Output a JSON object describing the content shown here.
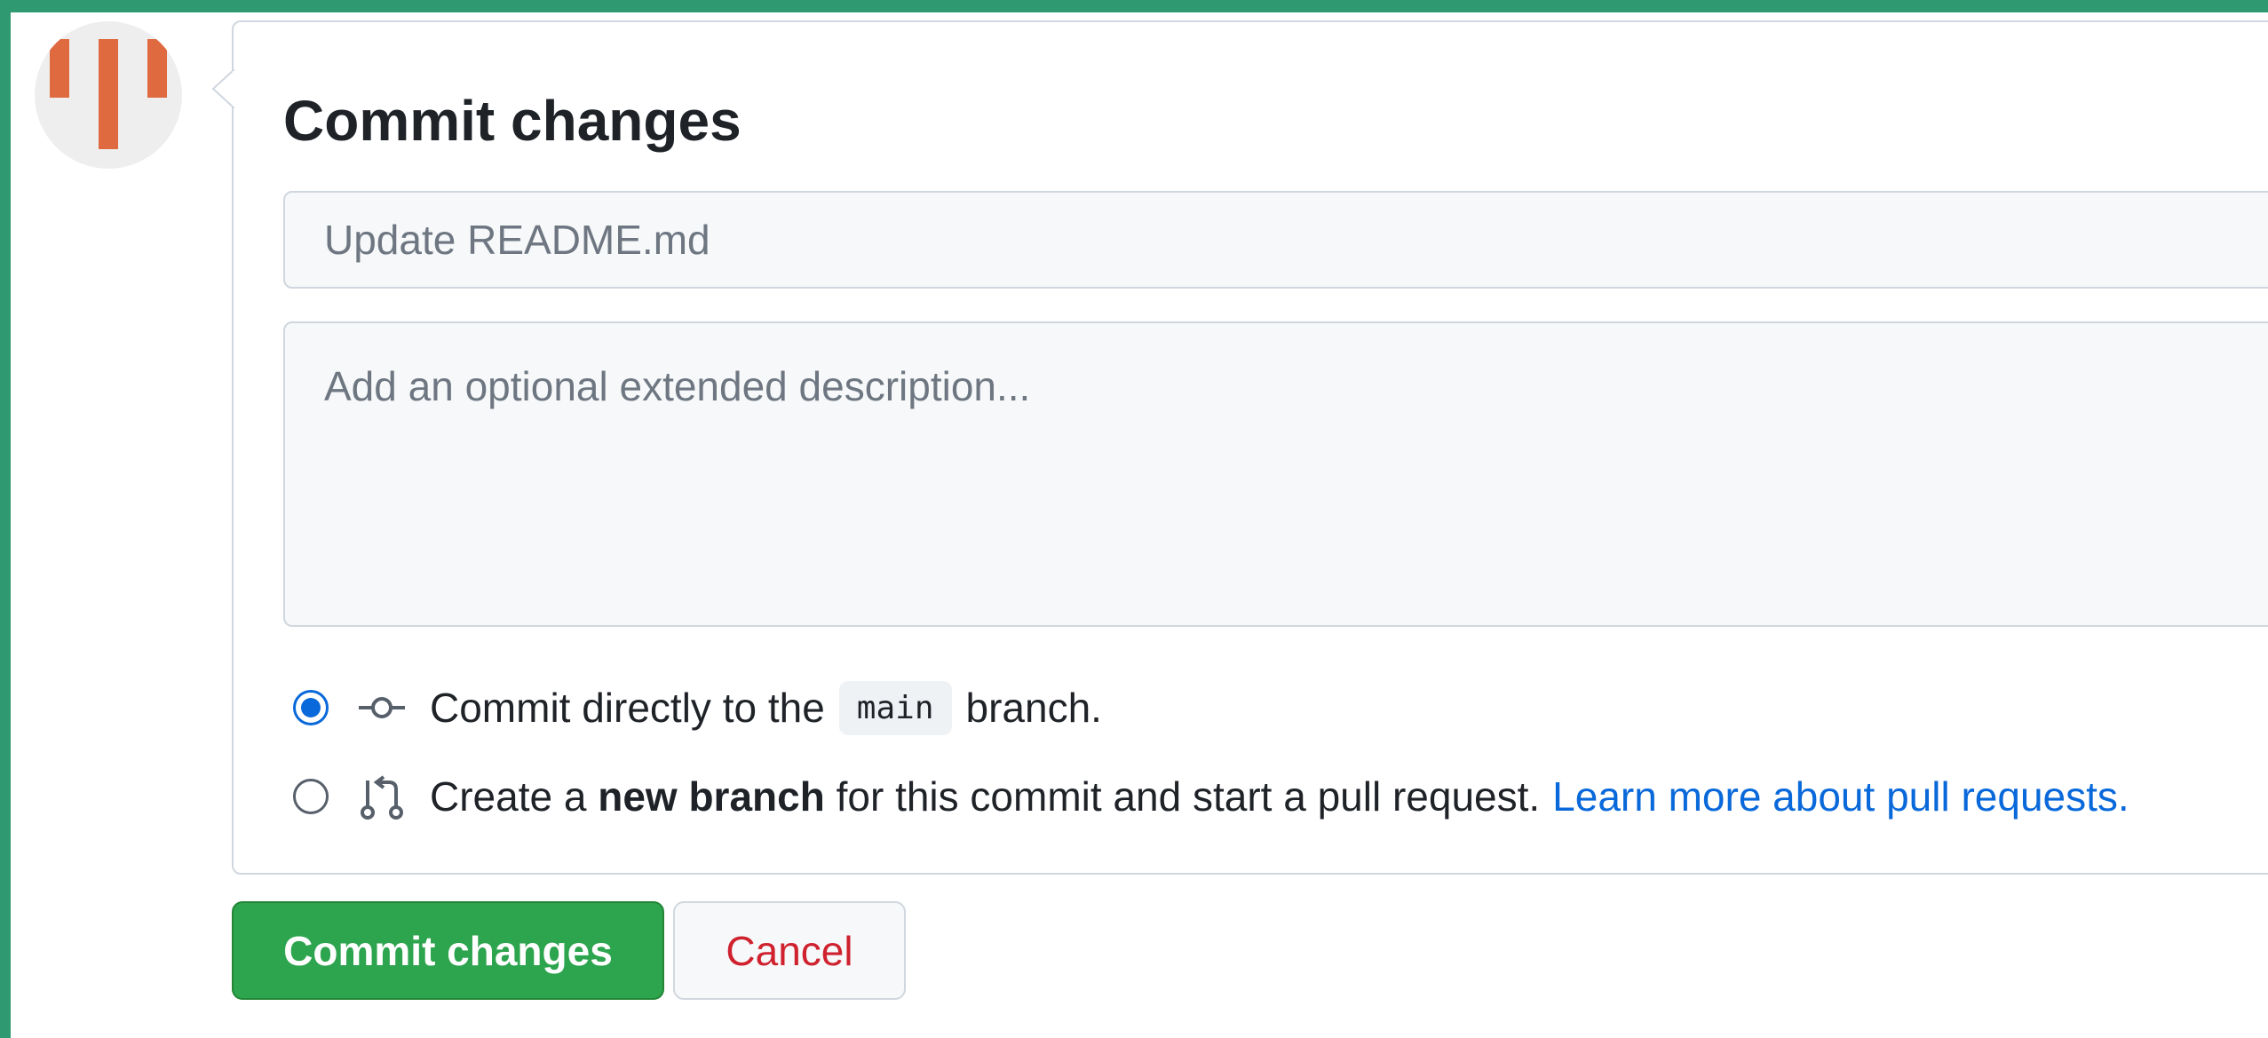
{
  "user": {
    "avatar_icon": "identicon-avatar-icon",
    "avatar_color": "#e06a3f"
  },
  "commit_form": {
    "title": "Commit changes",
    "summary_placeholder": "Update README.md",
    "summary_value": "",
    "description_placeholder": "Add an optional extended description...",
    "description_value": "",
    "options": {
      "direct": {
        "selected": true,
        "icon": "git-commit-icon",
        "text_before": "Commit directly to the",
        "branch": "main",
        "text_after": "branch."
      },
      "new_branch": {
        "selected": false,
        "icon": "git-pull-request-icon",
        "text_before": "Create a",
        "bold": "new branch",
        "text_after": "for this commit and start a pull request.",
        "link": "Learn more about pull requests."
      }
    }
  },
  "buttons": {
    "commit_label": "Commit changes",
    "cancel_label": "Cancel"
  },
  "colors": {
    "accent_green": "#2da44e",
    "link_blue": "#0969da",
    "danger_red": "#cf222e",
    "frame_green": "#2f9a72"
  }
}
